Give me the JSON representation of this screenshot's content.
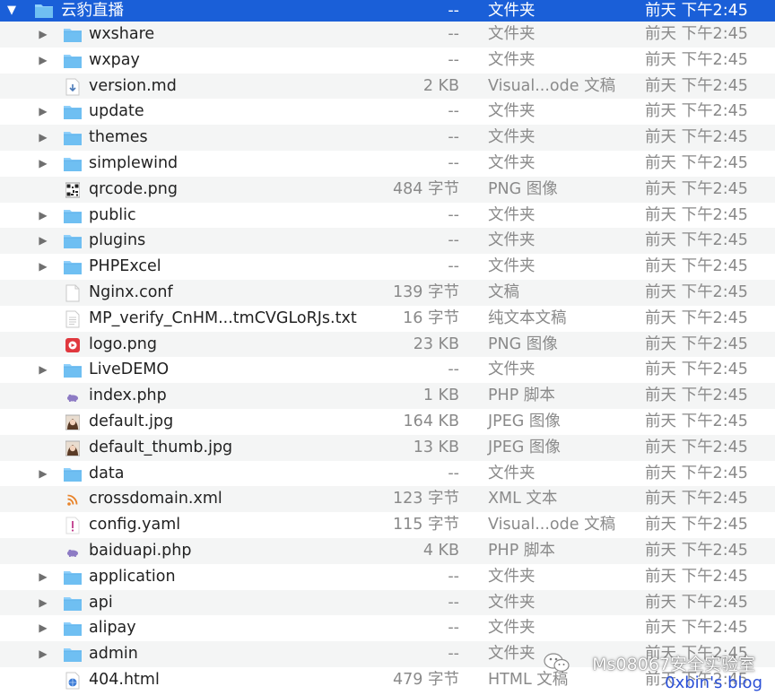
{
  "root": {
    "name": "云豹直播",
    "size": "--",
    "kind": "文件夹",
    "date": "前天 下午2:45"
  },
  "rows": [
    {
      "name": "wxshare",
      "size": "--",
      "kind": "文件夹",
      "date": "前天 下午2:45",
      "icon": "folder-icon"
    },
    {
      "name": "wxpay",
      "size": "--",
      "kind": "文件夹",
      "date": "前天 下午2:45",
      "icon": "folder-icon"
    },
    {
      "name": "version.md",
      "size": "2 KB",
      "kind": "Visual...ode 文稿",
      "date": "前天 下午2:45",
      "icon": "markdown-file-icon"
    },
    {
      "name": "update",
      "size": "--",
      "kind": "文件夹",
      "date": "前天 下午2:45",
      "icon": "folder-icon"
    },
    {
      "name": "themes",
      "size": "--",
      "kind": "文件夹",
      "date": "前天 下午2:45",
      "icon": "folder-icon"
    },
    {
      "name": "simplewind",
      "size": "--",
      "kind": "文件夹",
      "date": "前天 下午2:45",
      "icon": "folder-icon"
    },
    {
      "name": "qrcode.png",
      "size": "484 字节",
      "kind": "PNG 图像",
      "date": "前天 下午2:45",
      "icon": "qrcode-thumbnail-icon"
    },
    {
      "name": "public",
      "size": "--",
      "kind": "文件夹",
      "date": "前天 下午2:45",
      "icon": "folder-icon"
    },
    {
      "name": "plugins",
      "size": "--",
      "kind": "文件夹",
      "date": "前天 下午2:45",
      "icon": "folder-icon"
    },
    {
      "name": "PHPExcel",
      "size": "--",
      "kind": "文件夹",
      "date": "前天 下午2:45",
      "icon": "folder-icon"
    },
    {
      "name": "Nginx.conf",
      "size": "139 字节",
      "kind": "文稿",
      "date": "前天 下午2:45",
      "icon": "document-icon"
    },
    {
      "name": "MP_verify_CnHM...tmCVGLoRJs.txt",
      "size": "16 字节",
      "kind": "纯文本文稿",
      "date": "前天 下午2:45",
      "icon": "text-file-icon"
    },
    {
      "name": "logo.png",
      "size": "23 KB",
      "kind": "PNG 图像",
      "date": "前天 下午2:45",
      "icon": "logo-thumbnail-icon"
    },
    {
      "name": "LiveDEMO",
      "size": "--",
      "kind": "文件夹",
      "date": "前天 下午2:45",
      "icon": "folder-icon"
    },
    {
      "name": "index.php",
      "size": "1 KB",
      "kind": "PHP 脚本",
      "date": "前天 下午2:45",
      "icon": "php-file-icon"
    },
    {
      "name": "default.jpg",
      "size": "164 KB",
      "kind": "JPEG 图像",
      "date": "前天 下午2:45",
      "icon": "photo-thumbnail-icon"
    },
    {
      "name": "default_thumb.jpg",
      "size": "13 KB",
      "kind": "JPEG 图像",
      "date": "前天 下午2:45",
      "icon": "photo-thumbnail-icon"
    },
    {
      "name": "data",
      "size": "--",
      "kind": "文件夹",
      "date": "前天 下午2:45",
      "icon": "folder-icon"
    },
    {
      "name": "crossdomain.xml",
      "size": "123 字节",
      "kind": "XML 文本",
      "date": "前天 下午2:45",
      "icon": "rss-file-icon"
    },
    {
      "name": "config.yaml",
      "size": "115 字节",
      "kind": "Visual...ode 文稿",
      "date": "前天 下午2:45",
      "icon": "yaml-file-icon"
    },
    {
      "name": "baiduapi.php",
      "size": "4 KB",
      "kind": "PHP 脚本",
      "date": "前天 下午2:45",
      "icon": "php-file-icon"
    },
    {
      "name": "application",
      "size": "--",
      "kind": "文件夹",
      "date": "前天 下午2:45",
      "icon": "folder-icon"
    },
    {
      "name": "api",
      "size": "--",
      "kind": "文件夹",
      "date": "前天 下午2:45",
      "icon": "folder-icon"
    },
    {
      "name": "alipay",
      "size": "--",
      "kind": "文件夹",
      "date": "前天 下午2:45",
      "icon": "folder-icon"
    },
    {
      "name": "admin",
      "size": "--",
      "kind": "文件夹",
      "date": "前天 下午2:45",
      "icon": "folder-icon"
    },
    {
      "name": "404.html",
      "size": "479 字节",
      "kind": "HTML 文稿",
      "date": "前天 下午2:45",
      "icon": "html-file-icon"
    }
  ],
  "watermark": {
    "line1": "Ms08067安全实验室",
    "line2": "0xbin's blog"
  },
  "colors": {
    "selection": "#1a5fd8",
    "folder": "#6fbff2",
    "alt_row": "#f4f5f5",
    "muted_text": "#8a8a8a"
  }
}
